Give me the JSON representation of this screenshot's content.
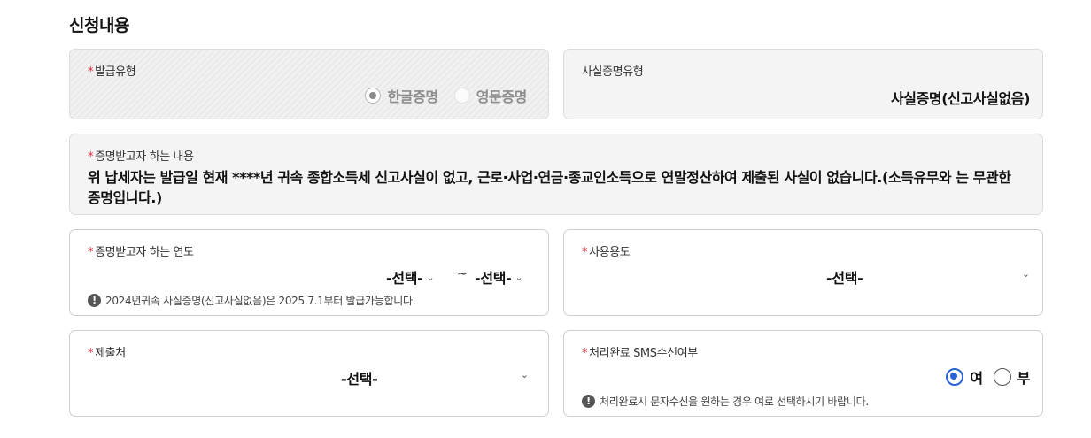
{
  "section_title": "신청내용",
  "issue_type": {
    "label": "발급유형",
    "required_mark": "*",
    "options": [
      {
        "label": "한글증명",
        "selected": true
      },
      {
        "label": "영문증명",
        "selected": false
      }
    ]
  },
  "fact_cert_type": {
    "label": "사실증명유형",
    "value": "사실증명(신고사실없음)"
  },
  "cert_content": {
    "label": "증명받고자 하는 내용",
    "required_mark": "*",
    "text": "위 납세자는 발급일 현재 ****년 귀속 종합소득세 신고사실이 없고, 근로·사업·연금·종교인소득으로 연말정산하여 제출된 사실이 없습니다.(소득유무와 는 무관한 증명입니다.)"
  },
  "cert_year": {
    "label": "증명받고자 하는 연도",
    "required_mark": "*",
    "from_value": "-선택-",
    "separator": "~",
    "to_value": "-선택-",
    "notice": "2024년귀속 사실증명(신고사실없음)은 2025.7.1부터 발급가능합니다."
  },
  "usage": {
    "label": "사용용도",
    "required_mark": "*",
    "value": "-선택-"
  },
  "submit_to": {
    "label": "제출처",
    "required_mark": "*",
    "value": "-선택-"
  },
  "sms": {
    "label": "처리완료 SMS수신여부",
    "required_mark": "*",
    "options": [
      {
        "label": "여",
        "selected": true
      },
      {
        "label": "부",
        "selected": false
      }
    ],
    "notice": "처리완료시 문자수신을 원하는 경우 여로 선택하시기 바랍니다."
  },
  "icons": {
    "chevron": "chevron-down-icon",
    "info": "info-icon",
    "info_glyph": "!",
    "chevron_glyph": "⌄"
  },
  "colors": {
    "required": "#e0283a",
    "radio_selected": "#2a63d6"
  }
}
